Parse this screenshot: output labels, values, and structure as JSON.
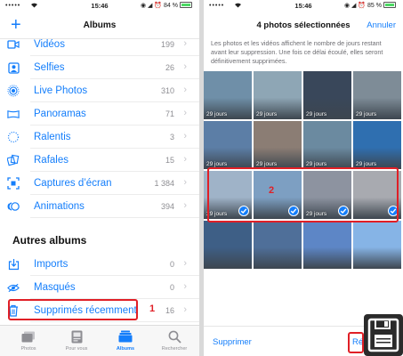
{
  "status_left": {
    "carrier": "•••••",
    "time": "15:46",
    "battery": "84 %"
  },
  "status_right": {
    "carrier": "•••••",
    "time": "15:46",
    "battery": "85 %"
  },
  "albums": {
    "title": "Albums",
    "add_label": "+",
    "media_types": [
      {
        "label": "Vidéos",
        "count": "199",
        "icon": "video-icon"
      },
      {
        "label": "Selfies",
        "count": "26",
        "icon": "selfie-icon"
      },
      {
        "label": "Live Photos",
        "count": "310",
        "icon": "live-photo-icon"
      },
      {
        "label": "Panoramas",
        "count": "71",
        "icon": "panorama-icon"
      },
      {
        "label": "Ralentis",
        "count": "3",
        "icon": "slow-motion-icon"
      },
      {
        "label": "Rafales",
        "count": "15",
        "icon": "burst-icon"
      },
      {
        "label": "Captures d’écran",
        "count": "1 384",
        "icon": "screenshot-icon"
      },
      {
        "label": "Animations",
        "count": "394",
        "icon": "animation-icon"
      }
    ],
    "other_header": "Autres albums",
    "other": [
      {
        "label": "Imports",
        "count": "0",
        "icon": "import-icon"
      },
      {
        "label": "Masqués",
        "count": "0",
        "icon": "hidden-eye-icon"
      },
      {
        "label": "Supprimés récemment",
        "count": "16",
        "icon": "trash-icon"
      }
    ],
    "tabs": [
      {
        "label": "Photos",
        "icon": "photos-tab-icon",
        "active": false
      },
      {
        "label": "Pour vous",
        "icon": "for-you-tab-icon",
        "active": false
      },
      {
        "label": "Albums",
        "icon": "albums-tab-icon",
        "active": true
      },
      {
        "label": "Rechercher",
        "icon": "search-tab-icon",
        "active": false
      }
    ]
  },
  "recent": {
    "title": "4 photos sélectionnées",
    "cancel_label": "Annuler",
    "info": "Les photos et les vidéos affichent le nombre de jours restant avant leur suppression. Une fois ce délai écoulé, elles seront définitivement supprimées.",
    "days_label": "29 jours",
    "delete_label": "Supprimer",
    "recover_label": "Réc",
    "photos": [
      {
        "tone": "#6f8fa8",
        "selected": false,
        "show_days": true
      },
      {
        "tone": "#8ea6b5",
        "selected": false,
        "show_days": true
      },
      {
        "tone": "#39475a",
        "selected": false,
        "show_days": true
      },
      {
        "tone": "#7e8c97",
        "selected": false,
        "show_days": true
      },
      {
        "tone": "#5c7ea6",
        "selected": false,
        "show_days": true
      },
      {
        "tone": "#8b7d74",
        "selected": false,
        "show_days": true
      },
      {
        "tone": "#6b8aa0",
        "selected": false,
        "show_days": true
      },
      {
        "tone": "#2f6fb0",
        "selected": false,
        "show_days": true
      },
      {
        "tone": "#9fb3c8",
        "selected": true,
        "show_days": true
      },
      {
        "tone": "#7d9fc2",
        "selected": true,
        "show_days": false
      },
      {
        "tone": "#8d93a0",
        "selected": true,
        "show_days": true
      },
      {
        "tone": "#a8aab0",
        "selected": true,
        "show_days": false
      },
      {
        "tone": "#3e5f86",
        "selected": false,
        "show_days": false
      },
      {
        "tone": "#4f6f99",
        "selected": false,
        "show_days": false
      },
      {
        "tone": "#5d86c6",
        "selected": false,
        "show_days": false
      },
      {
        "tone": "#86b4e6",
        "selected": false,
        "show_days": false
      }
    ]
  },
  "annotations": {
    "marker_1": "1",
    "marker_2": "2"
  },
  "colors": {
    "accent": "#147efb",
    "highlight_red": "#e01f26"
  }
}
